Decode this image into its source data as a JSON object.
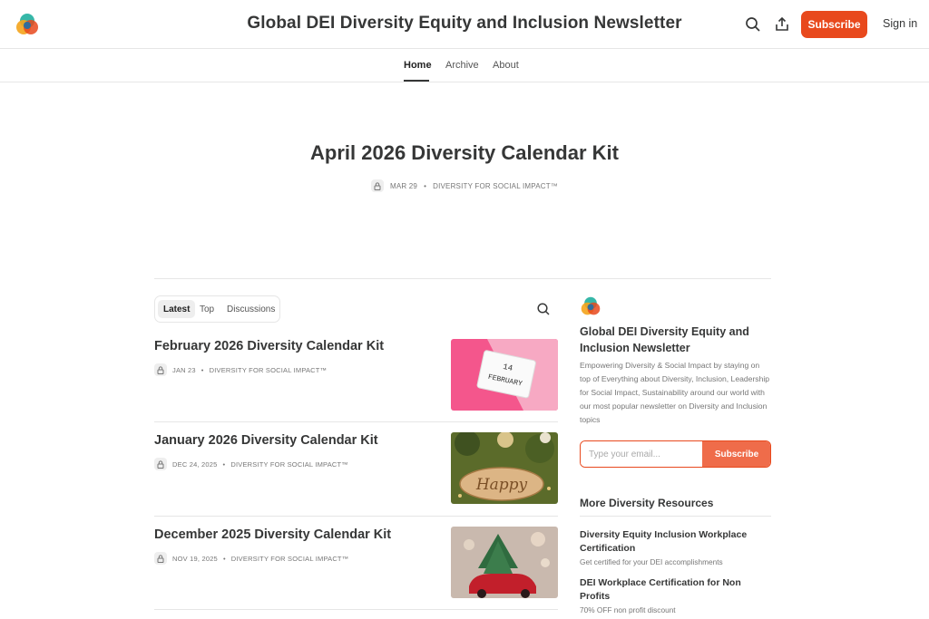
{
  "header": {
    "title": "Global DEI Diversity Equity and Inclusion Newsletter",
    "subscribe_label": "Subscribe",
    "signin_label": "Sign in"
  },
  "nav": {
    "items": [
      {
        "label": "Home",
        "active": true
      },
      {
        "label": "Archive",
        "active": false
      },
      {
        "label": "About",
        "active": false
      }
    ]
  },
  "featured": {
    "title": "April 2026 Diversity Calendar Kit",
    "date": "MAR 29",
    "author": "DIVERSITY FOR SOCIAL IMPACT™"
  },
  "tabs": {
    "items": [
      {
        "label": "Latest",
        "active": true
      },
      {
        "label": "Top",
        "active": false
      },
      {
        "label": "Discussions",
        "active": false
      }
    ]
  },
  "posts": [
    {
      "title": "February 2026 Diversity Calendar Kit",
      "date": "JAN 23",
      "author": "DIVERSITY FOR SOCIAL IMPACT™",
      "thumb_text": [
        "14",
        "FEBRUARY"
      ]
    },
    {
      "title": "January 2026 Diversity Calendar Kit",
      "date": "DEC 24, 2025",
      "author": "DIVERSITY FOR SOCIAL IMPACT™",
      "thumb_text": [
        "Happy"
      ]
    },
    {
      "title": "December 2025 Diversity Calendar Kit",
      "date": "NOV 19, 2025",
      "author": "DIVERSITY FOR SOCIAL IMPACT™",
      "thumb_text": []
    }
  ],
  "sidebar": {
    "title": "Global DEI Diversity Equity and Inclusion Newsletter",
    "description": "Empowering Diversity & Social Impact by staying on top of Everything about Diversity, Inclusion, Leadership for Social Impact, Sustainability around our world with our most popular newsletter on Diversity and Inclusion topics",
    "email_placeholder": "Type your email...",
    "email_value": "",
    "subscribe_label": "Subscribe",
    "resources_heading": "More Diversity Resources",
    "resources": [
      {
        "title": "Diversity Equity Inclusion Workplace Certification",
        "subtitle": "Get certified for your DEI accomplishments"
      },
      {
        "title": "DEI Workplace Certification for Non Profits",
        "subtitle": "70% OFF non profit discount"
      }
    ]
  },
  "icons": {
    "logo": "overlapping-circles-logo-icon",
    "search": "search-icon",
    "share": "share-icon",
    "lock": "lock-icon"
  },
  "colors": {
    "accent": "#e8491d",
    "accent_light": "#ef6c4a",
    "text": "#363737",
    "muted": "#777777",
    "border": "#e6e6e6"
  }
}
